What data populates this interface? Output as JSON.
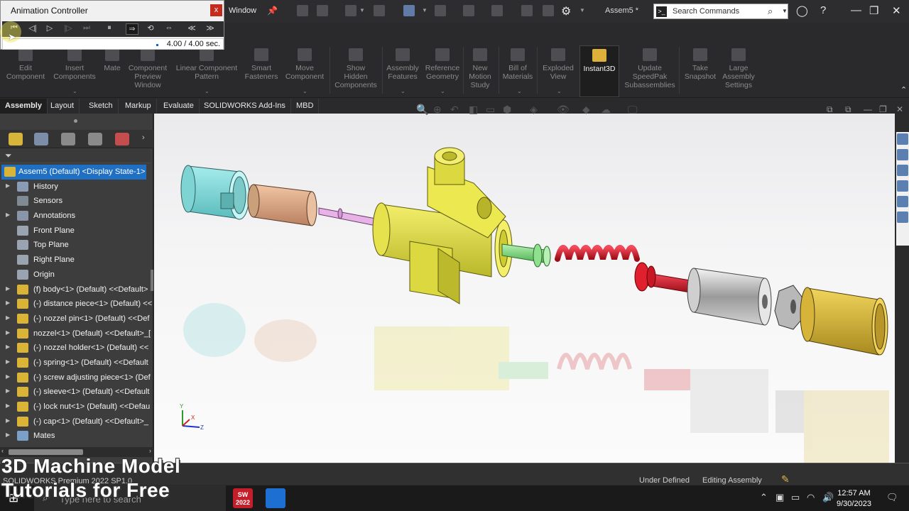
{
  "animation_controller": {
    "title": "Animation Controller",
    "close_glyph": "x",
    "time_readout": "4.00 / 4.00 sec.",
    "progress": 1.0
  },
  "title_bar": {
    "menu_window": "Window",
    "document_title": "Assem5 *",
    "search_placeholder": "Search Commands"
  },
  "ribbon": {
    "buttons": [
      {
        "label": "Edit\nComponent",
        "enabled": false
      },
      {
        "label": "Insert\nComponents",
        "enabled": false
      },
      {
        "label": "Mate",
        "enabled": false
      },
      {
        "label": "Component\nPreview\nWindow",
        "enabled": false
      },
      {
        "label": "Linear Component\nPattern",
        "enabled": false
      },
      {
        "label": "Smart\nFasteners",
        "enabled": false
      },
      {
        "label": "Move\nComponent",
        "enabled": false
      },
      {
        "label": "Show\nHidden\nComponents",
        "enabled": false
      },
      {
        "label": "Assembly\nFeatures",
        "enabled": false
      },
      {
        "label": "Reference\nGeometry",
        "enabled": false
      },
      {
        "label": "New\nMotion\nStudy",
        "enabled": false
      },
      {
        "label": "Bill of\nMaterials",
        "enabled": false
      },
      {
        "label": "Exploded\nView",
        "enabled": false
      },
      {
        "label": "Instant3D",
        "enabled": true,
        "active": true
      },
      {
        "label": "Update\nSpeedPak\nSubassemblies",
        "enabled": false
      },
      {
        "label": "Take\nSnapshot",
        "enabled": false
      },
      {
        "label": "Large\nAssembly\nSettings",
        "enabled": false
      }
    ]
  },
  "command_tabs": [
    "Assembly",
    "Layout",
    "Sketch",
    "Markup",
    "Evaluate",
    "SOLIDWORKS Add-Ins",
    "MBD"
  ],
  "feature_tree": {
    "root": "Assem5 (Default) <Display State-1>",
    "items": [
      {
        "label": "History",
        "icon": "history-icon",
        "expandable": true
      },
      {
        "label": "Sensors",
        "icon": "sensor-icon",
        "expandable": false
      },
      {
        "label": "Annotations",
        "icon": "annotation-icon",
        "expandable": true
      },
      {
        "label": "Front Plane",
        "icon": "plane-icon",
        "expandable": false
      },
      {
        "label": "Top Plane",
        "icon": "plane-icon",
        "expandable": false
      },
      {
        "label": "Right Plane",
        "icon": "plane-icon",
        "expandable": false
      },
      {
        "label": "Origin",
        "icon": "origin-icon",
        "expandable": false
      },
      {
        "label": "(f) body<1> (Default) <<Default>",
        "icon": "part-icon",
        "expandable": true
      },
      {
        "label": "(-) distance piece<1> (Default) <<",
        "icon": "part-icon",
        "expandable": true
      },
      {
        "label": "(-) nozzel pin<1> (Default) <<Def",
        "icon": "part-icon",
        "expandable": true
      },
      {
        "label": "nozzel<1> (Default) <<Default>_[",
        "icon": "part-icon",
        "expandable": true
      },
      {
        "label": "(-) nozzel holder<1> (Default) <<",
        "icon": "part-icon",
        "expandable": true
      },
      {
        "label": "(-) spring<1> (Default) <<Default",
        "icon": "part-icon",
        "expandable": true
      },
      {
        "label": "(-) screw adjusting piece<1> (Def",
        "icon": "part-icon",
        "expandable": true
      },
      {
        "label": "(-) sleeve<1> (Default) <<Default",
        "icon": "part-icon",
        "expandable": true
      },
      {
        "label": "(-) lock nut<1> (Default) <<Defau",
        "icon": "part-icon",
        "expandable": true
      },
      {
        "label": "(-) cap<1> (Default) <<Default>_",
        "icon": "part-icon",
        "expandable": true
      },
      {
        "label": "Mates",
        "icon": "mates-icon",
        "expandable": true
      }
    ]
  },
  "triad": {
    "x": "X",
    "y": "Y",
    "z": "Z"
  },
  "status_bar": {
    "product": "SOLIDWORKS Premium 2022 SP1.0",
    "state": "Under Defined",
    "mode": "Editing Assembly"
  },
  "taskbar": {
    "search_placeholder": "Type here to search",
    "app_sw_label": "SW\n2022",
    "time": "12:57 AM",
    "date": "9/30/2023"
  },
  "watermark": {
    "line1": "3D Machine Model",
    "line2": "Tutorials for Free"
  },
  "colors": {
    "accent": "#1f6fc3",
    "part_yellow": "#e2d83a",
    "spring_red": "#cc1a24",
    "pin_green": "#6ccf6c",
    "distance_cyan": "#7fd6d6",
    "sleeve_tan": "#d9a27a",
    "cap_gold": "#d6b43a"
  }
}
